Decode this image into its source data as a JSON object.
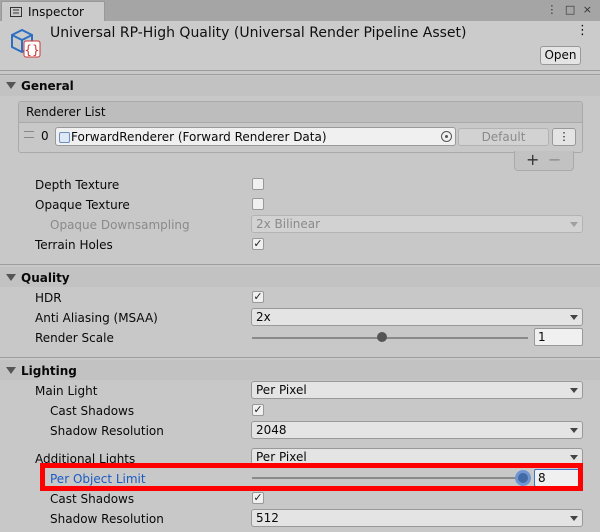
{
  "tab": {
    "label": "Inspector",
    "controls": "⋮ □ ×"
  },
  "header": {
    "title": "Universal RP-High Quality (Universal Render Pipeline Asset)",
    "kebab": "⋮",
    "open_label": "Open"
  },
  "sections": {
    "general": "General",
    "quality": "Quality",
    "lighting": "Lighting"
  },
  "renderer_list": {
    "label": "Renderer List",
    "index": "0",
    "value": "ForwardRenderer (Forward Renderer Data)",
    "default_label": "Default",
    "kebab": "⋮",
    "plus": "+",
    "minus": "−"
  },
  "general": {
    "depth_texture": {
      "label": "Depth Texture",
      "checked": false
    },
    "opaque_texture": {
      "label": "Opaque Texture",
      "checked": false
    },
    "opaque_downsampling": {
      "label": "Opaque Downsampling",
      "value": "2x Bilinear",
      "disabled": true
    },
    "terrain_holes": {
      "label": "Terrain Holes",
      "checked": true
    }
  },
  "quality": {
    "hdr": {
      "label": "HDR",
      "checked": true
    },
    "msaa": {
      "label": "Anti Aliasing (MSAA)",
      "value": "2x"
    },
    "render_scale": {
      "label": "Render Scale",
      "value": "1",
      "fraction": 0.47
    }
  },
  "lighting": {
    "main_light": {
      "label": "Main Light",
      "value": "Per Pixel"
    },
    "main_cast_shadows": {
      "label": "Cast Shadows",
      "checked": true
    },
    "main_shadow_resolution": {
      "label": "Shadow Resolution",
      "value": "2048"
    },
    "additional_lights": {
      "label": "Additional Lights",
      "value": "Per Pixel"
    },
    "per_object_limit": {
      "label": "Per Object Limit",
      "value": "8",
      "fraction": 1.0
    },
    "add_cast_shadows": {
      "label": "Cast Shadows",
      "checked": true
    },
    "add_shadow_resolution": {
      "label": "Shadow Resolution",
      "value": "512"
    }
  },
  "colors": {
    "highlight_box": "#ff0000",
    "highlight_label": "#1b5bc4",
    "slider_active": "#446aa5"
  }
}
